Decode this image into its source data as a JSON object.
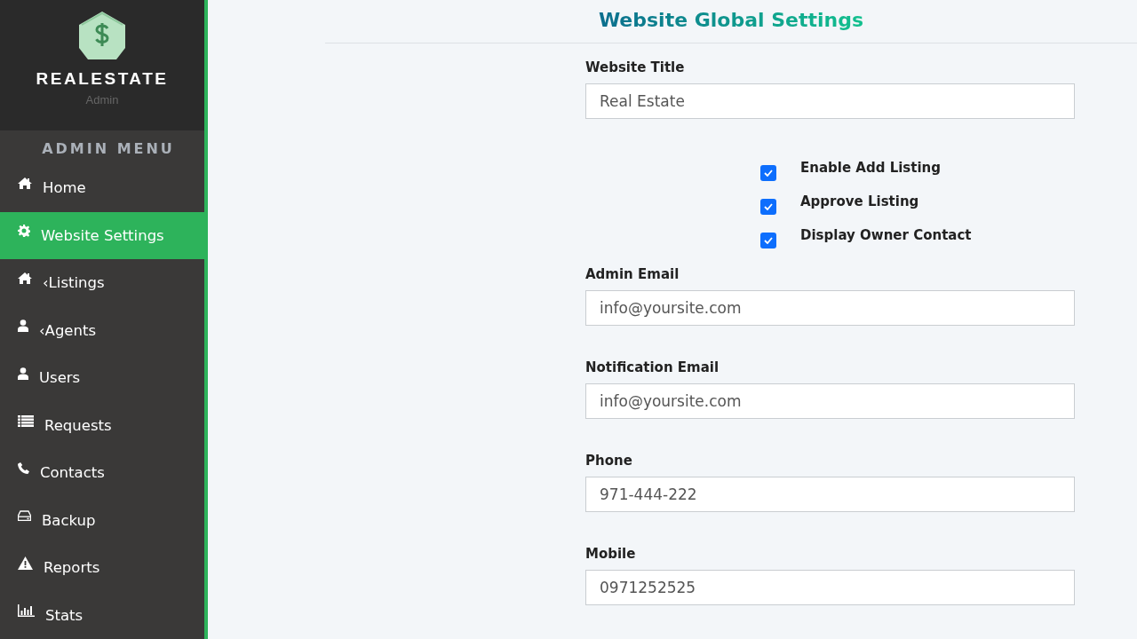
{
  "brand": {
    "name": "REALESTATE",
    "subtitle": "Admin"
  },
  "sidebar": {
    "heading": "ADMIN MENU",
    "items": [
      {
        "label": "Home",
        "selected": false
      },
      {
        "label": "Website Settings",
        "selected": true
      },
      {
        "label": "‹Listings",
        "selected": false
      },
      {
        "label": "‹Agents",
        "selected": false
      },
      {
        "label": "Users",
        "selected": false
      },
      {
        "label": "Requests",
        "selected": false
      },
      {
        "label": "Contacts",
        "selected": false
      },
      {
        "label": "Backup",
        "selected": false
      },
      {
        "label": "Reports",
        "selected": false
      },
      {
        "label": "Stats",
        "selected": false
      }
    ]
  },
  "page_title": "Website Global Settings",
  "form": [
    {
      "kind": "field",
      "label": "Website Title",
      "value": "Real Estate"
    },
    {
      "kind": "checks",
      "options": [
        {
          "label": "Enable Add Listing",
          "checked": true
        },
        {
          "label": "Approve Listing",
          "checked": true
        },
        {
          "label": "Display Owner Contact",
          "checked": true
        }
      ]
    },
    {
      "kind": "field",
      "label": "Admin Email",
      "value": "info@yoursite.com"
    },
    {
      "kind": "field",
      "label": "Notification Email",
      "value": "info@yoursite.com"
    },
    {
      "kind": "field",
      "label": "Phone",
      "value": "971-444-222"
    },
    {
      "kind": "field",
      "label": "Mobile",
      "value": "0971252525"
    }
  ]
}
